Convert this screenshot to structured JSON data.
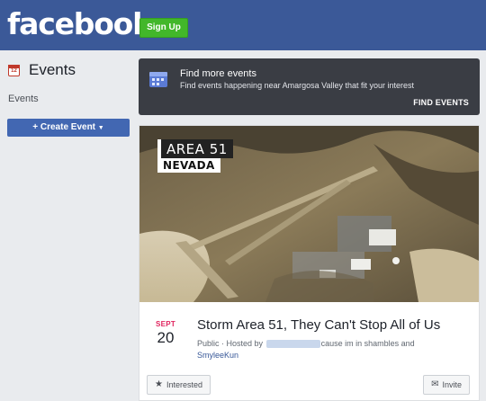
{
  "header": {
    "logo": "facebook",
    "signup_label": "Sign Up"
  },
  "sidebar": {
    "title": "Events",
    "calendar_day": "12",
    "sub_label": "Events",
    "create_label": "Create Event"
  },
  "find_events": {
    "title": "Find more events",
    "description": "Find events happening near Amargosa Valley that fit your interest",
    "link": "FIND EVENTS"
  },
  "event": {
    "image_text_top": "AREA 51",
    "image_text_bottom": "NEVADA",
    "month": "SEPT",
    "day": "20",
    "title": "Storm Area 51, They Can't Stop All of Us",
    "meta_prefix": "Public · Hosted by",
    "host1": "cause im in shambles and",
    "host2": "SmyleeKun",
    "interested_label": "Interested",
    "invite_label": "Invite"
  },
  "colors": {
    "brand": "#3b5998",
    "signup": "#42b72a",
    "create_button": "#4267b2",
    "find_box": "#3a3d44"
  }
}
